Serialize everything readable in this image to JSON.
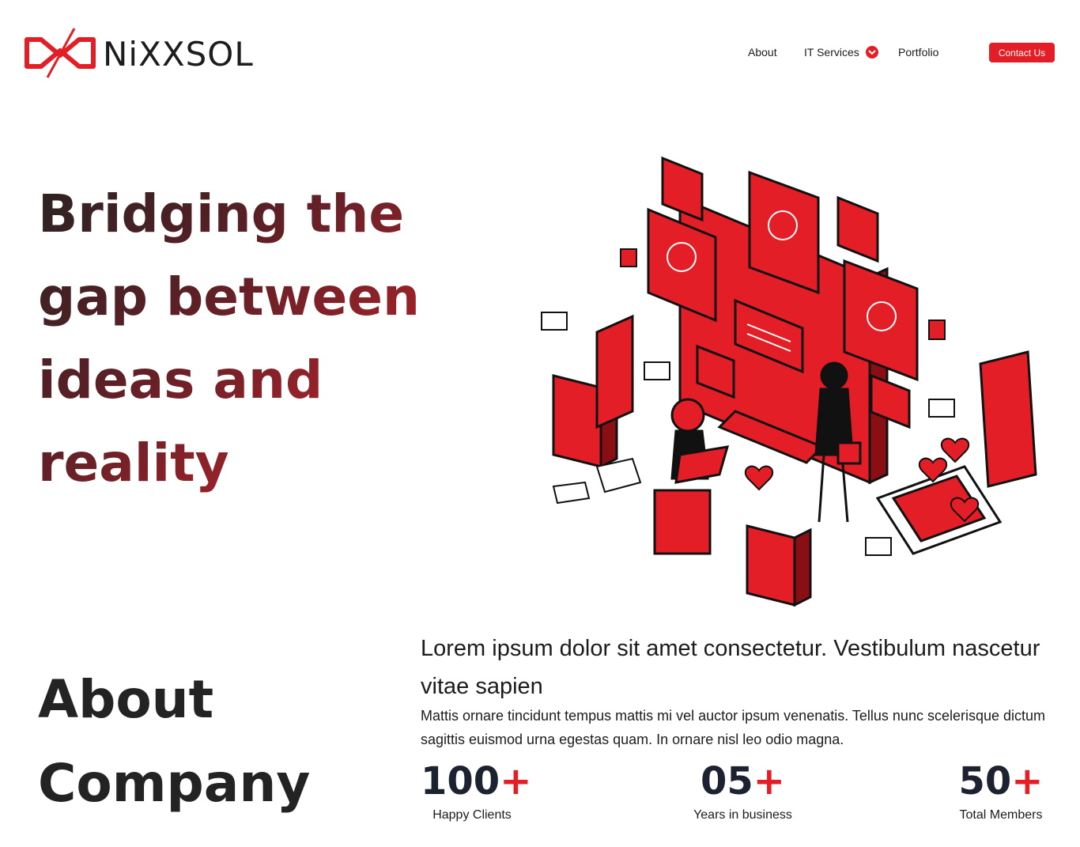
{
  "brand": {
    "name": "NiXXSOL",
    "logo_icon": "nixxsol-logo-icon",
    "accent": "#e31e26"
  },
  "nav": {
    "items": [
      {
        "label": "About"
      },
      {
        "label": "IT Services",
        "icon": "chevron-down-icon"
      },
      {
        "label": "Portfolio"
      }
    ],
    "contact_label": "Contact Us"
  },
  "hero": {
    "title_lines": [
      "Bridging the",
      "gap between",
      "ideas and",
      "reality"
    ],
    "illustration": "isometric-digital-team-illustration"
  },
  "about": {
    "title_lines": [
      "About",
      "Company"
    ],
    "lead": "Lorem ipsum dolor sit amet consectetur. Vestibulum nascetur vitae sapien",
    "body": "Mattis ornare tincidunt tempus mattis mi vel auctor ipsum venenatis. Tellus nunc scelerisque dictum sagittis euismod urna egestas quam. In ornare nisl leo odio magna.",
    "stats": [
      {
        "value": "100",
        "suffix": "+",
        "label": "Happy Clients"
      },
      {
        "value": "05",
        "suffix": "+",
        "label": "Years in business"
      },
      {
        "value": "50",
        "suffix": "+",
        "label": "Total Members"
      }
    ]
  },
  "colors": {
    "accent": "#e31e26",
    "dark": "#1c2230"
  }
}
